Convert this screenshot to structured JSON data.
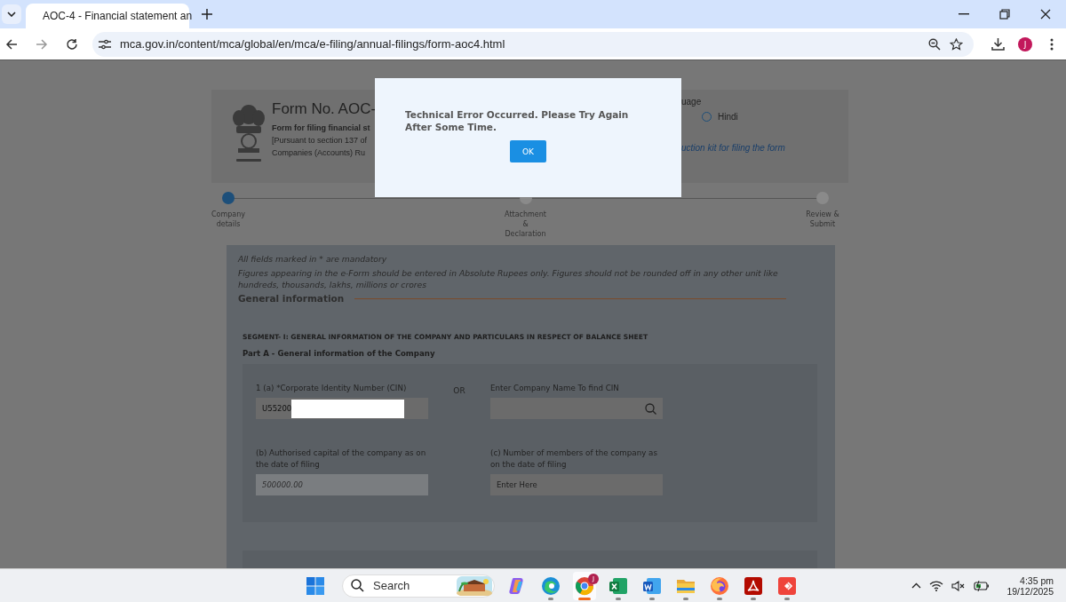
{
  "browser": {
    "tab": {
      "title": "AOC-4 - Financial statement an",
      "selected": true
    },
    "url": "mca.gov.in/content/mca/global/en/mca/e-filing/annual-filings/form-aoc4.html",
    "profile": "J"
  },
  "header": {
    "title": "Form No. AOC-",
    "subtitle": "Form for filing financial st",
    "lines": [
      "[Pursuant to section 137 of",
      "Companies (Accounts) Ru"
    ],
    "language_label": "uage",
    "languages": [
      {
        "label": "Hindi",
        "selected": false
      }
    ],
    "link": "uction kit for filing the form"
  },
  "steps": [
    {
      "label": "Company details",
      "selected": true
    },
    {
      "label": "Attachment & Declaration",
      "selected": false
    },
    {
      "label": "Review & Submit",
      "selected": false
    }
  ],
  "notes": [
    "All fields marked in * are mandatory",
    "Figures appearing in the e-Form should be entered in Absolute Rupees only. Figures should not be rounded off in any other unit like hundreds, thousands, lakhs, millions or crores"
  ],
  "section": "General information",
  "segment": "SEGMENT- I: GENERAL INFORMATION OF THE COMPANY AND PARTICULARS IN RESPECT OF BALANCE SHEET",
  "part": "Part A - General information of the Company",
  "or_text": "OR",
  "fields": [
    {
      "kind": "text",
      "label": "1 (a) *Corporate Identity Number (CIN)",
      "value": "U55200",
      "redacted": true
    },
    {
      "kind": "search",
      "label": "Enter Company Name To find CIN"
    },
    {
      "kind": "text",
      "label": "(b) Authorised capital of the company as on the date of filing",
      "value": "500000.00",
      "disabled": true
    },
    {
      "kind": "text",
      "label": "(c) Number of members of the company as on the date of filing",
      "placeholder": "Enter Here"
    }
  ],
  "modal": {
    "message": "Technical Error Occurred. Please Try Again After Some Time.",
    "button": "OK"
  },
  "taskbar": {
    "search_placeholder": "Search",
    "apps": [
      {
        "kind": "copilot",
        "selected": false,
        "running": false
      },
      {
        "kind": "edge",
        "selected": false,
        "running": true
      },
      {
        "kind": "chrome",
        "selected": true,
        "running": true,
        "badge": "J"
      },
      {
        "kind": "excel",
        "selected": false,
        "running": true
      },
      {
        "kind": "word",
        "selected": false,
        "running": true
      },
      {
        "kind": "files",
        "selected": false,
        "running": true
      },
      {
        "kind": "firefox",
        "selected": false,
        "running": true
      },
      {
        "kind": "acrobat",
        "selected": false,
        "running": true
      },
      {
        "kind": "anydesk",
        "selected": false,
        "running": true
      }
    ],
    "time": "4:35 pm",
    "date": "19/12/2025"
  }
}
